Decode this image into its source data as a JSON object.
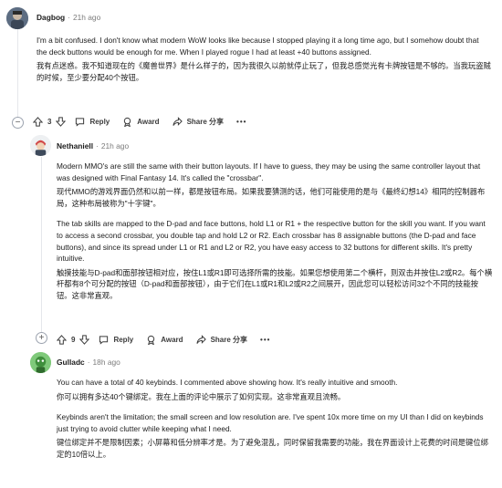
{
  "comments": [
    {
      "username": "Dagbog",
      "time": "21h ago",
      "body_en": "I'm a bit confused. I don't know what modern WoW looks like because I stopped playing it a long time ago, but I somehow doubt that the deck buttons would be enough for me. When I played rogue I had at least +40 buttons assigned.",
      "body_zh": "我有点迷惑。我不知道现在的《魔兽世界》是什么样子的，因为我很久以前就停止玩了，但我总感觉光有卡牌按钮是不够的。当我玩盗贼的时候，至少要分配40个按钮。",
      "votes": "3",
      "reply": "Reply",
      "award": "Award",
      "share": "Share 分享",
      "more": "•••"
    },
    {
      "username": "Nethaniell",
      "time": "21h ago",
      "body_en1": "Modern MMO's are still the same with their button layouts. If I have to guess, they may be using the same controller layout that was designed with Final Fantasy 14. It's called the \"crossbar\".",
      "body_zh1": "现代MMO的游戏界面仍然和以前一样，都是按钮布局。如果我要猜测的话，他们可能使用的是与《最终幻想14》相同的控制器布局，这种布局被称为\"十字键\"。",
      "body_en2": "The tab skills are mapped to the D-pad and face buttons, hold L1 or R1 + the respective button for the skill you want. If you want to access a second crossbar, you double tap and hold L2 or R2. Each crossbar has 8 assignable buttons (the D-pad and face buttons), and since its spread under L1 or R1 and L2 or R2, you have easy access to 32 buttons for different skills. It's pretty intuitive.",
      "body_zh2": "触摸技能与D-pad和面部按钮相对应，按住L1或R1即可选择所需的技能。如果您想使用第二个横杆，则双击并按住L2或R2。每个横杆都有8个可分配的按钮（D-pad和面部按钮），由于它们在L1或R1和L2或R2之间展开，因此您可以轻松访问32个不同的技能按钮。这非常直观。",
      "votes": "9",
      "reply": "Reply",
      "award": "Award",
      "share": "Share 分享",
      "more": "•••"
    },
    {
      "username": "Gulladc",
      "time": "18h ago",
      "body_en1": "You can have a total of 40 keybinds. I commented above showing how. It's really intuitive and smooth.",
      "body_zh1": "你可以拥有多达40个键绑定。我在上面的评论中展示了如何实现。这非常直观且流畅。",
      "body_en2": "Keybinds aren't the limitation; the small screen and low resolution are. I've spent 10x more time on my UI than I did on keybinds just trying to avoid clutter while keeping what I need.",
      "body_zh2": "键位绑定并不是限制因素；小屏幕和低分辨率才是。为了避免混乱，同时保留我需要的功能，我在界面设计上花费的时间是键位绑定的10倍以上。"
    }
  ],
  "colors": {
    "upvote": "#1c1c1c",
    "meta": "#7c7c7c",
    "thread": "#e5e7eb"
  },
  "icons": [
    "upvote-icon",
    "downvote-icon",
    "comment-icon",
    "award-icon",
    "share-icon",
    "more-icon",
    "collapse-icon",
    "expand-icon"
  ]
}
